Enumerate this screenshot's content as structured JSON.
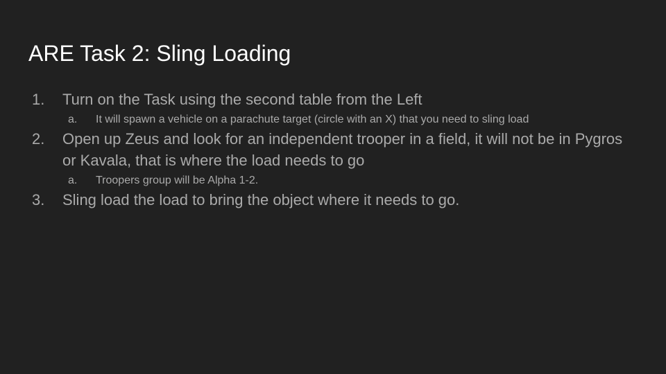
{
  "slide": {
    "title": "ARE Task 2: Sling Loading",
    "items": [
      {
        "marker": "1.",
        "text": "Turn on the Task using the second table from the Left",
        "sub": [
          {
            "marker": "a.",
            "text": "It will spawn a vehicle on a parachute target (circle with an X) that you need to sling load"
          }
        ]
      },
      {
        "marker": "2.",
        "text": "Open up Zeus and look for an independent trooper in a field, it will not be in Pygros or Kavala, that is where the load needs to go",
        "sub": [
          {
            "marker": "a.",
            "text": "Troopers group will be Alpha 1-2."
          }
        ]
      },
      {
        "marker": "3.",
        "text": "Sling load the load to bring the object where it needs to go.",
        "sub": []
      }
    ],
    "colors": {
      "background": "#212121",
      "title": "#ffffff",
      "body": "#aaaaaa"
    }
  }
}
